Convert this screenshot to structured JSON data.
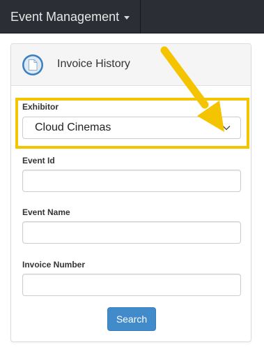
{
  "navbar": {
    "brand": "Event Management",
    "brand_icon": "caret-down-icon"
  },
  "panel": {
    "title": "Invoice History",
    "title_icon": "document-icon"
  },
  "form": {
    "exhibitor": {
      "label": "Exhibitor",
      "value": "Cloud Cinemas"
    },
    "event_id": {
      "label": "Event Id",
      "value": ""
    },
    "event_name": {
      "label": "Event Name",
      "value": ""
    },
    "invoice_number": {
      "label": "Invoice Number",
      "value": ""
    },
    "search_button": "Search"
  },
  "annotation": {
    "highlight_color": "#f5c400",
    "arrow_color": "#f5c400"
  },
  "colors": {
    "navbar_bg": "#2b2f35",
    "primary_button": "#428bca",
    "icon_blue": "#3a7fc1"
  }
}
